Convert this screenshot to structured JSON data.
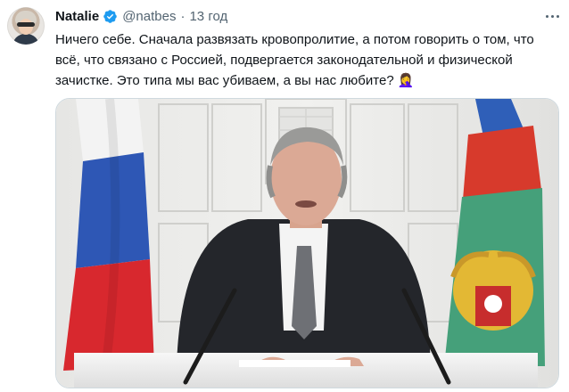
{
  "tweet": {
    "author_name": "Natalie",
    "author_handle": "@natbes",
    "separator": "·",
    "time": "13 год",
    "text": "Ничего себе. Сначала развязать кровопролитие, а потом говорить о том, что всё, что связано с Россией, подвергается законодательной и физической зачистке. Это типа мы вас убиваем, а вы нас любите?",
    "emoji": "🤦‍♀️"
  },
  "icons": {
    "avatar": "profile-photo",
    "verified": "verified-badge-icon",
    "more": "more-options-icon"
  },
  "colors": {
    "verified": "#1d9bf0",
    "secondary_text": "#536471",
    "border": "#cfd9de"
  }
}
